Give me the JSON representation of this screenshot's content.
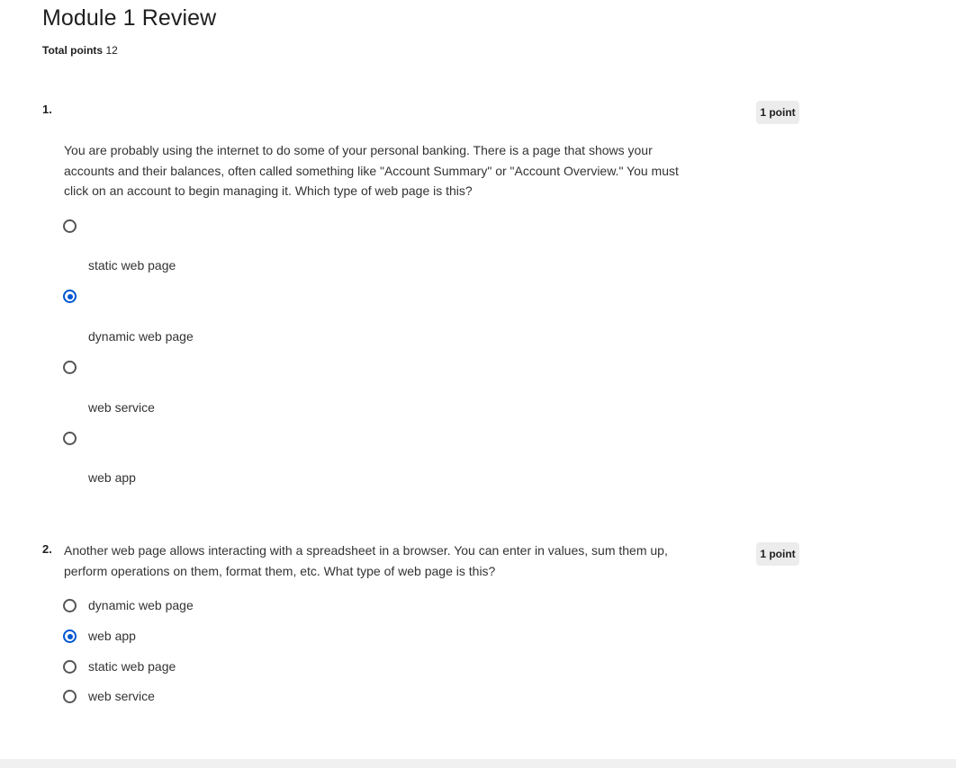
{
  "header": {
    "title": "Module 1 Review",
    "total_points_label": "Total points",
    "total_points_value": "12"
  },
  "questions": [
    {
      "number": "1.",
      "points": "1 point",
      "prompt": "You are probably using the internet to do some of your personal banking. There is a page that shows your accounts and their balances, often called something like \"Account Summary\" or \"Account Overview.\" You must click on an account to begin managing it. Which type of web page is this?",
      "options": [
        {
          "label": "static web page",
          "selected": false
        },
        {
          "label": "dynamic web page",
          "selected": true
        },
        {
          "label": "web service",
          "selected": false
        },
        {
          "label": "web app",
          "selected": false
        }
      ]
    },
    {
      "number": "2.",
      "points": "1 point",
      "prompt": "Another web page allows interacting with a spreadsheet in a browser. You can enter in values, sum them up, perform operations on them, format them, etc. What type of web page is this?",
      "options": [
        {
          "label": "dynamic web page",
          "selected": false
        },
        {
          "label": "web app",
          "selected": true
        },
        {
          "label": "static web page",
          "selected": false
        },
        {
          "label": "web service",
          "selected": false
        }
      ]
    }
  ],
  "colors": {
    "accent": "#0056d2",
    "badge_bg": "#ececec"
  }
}
